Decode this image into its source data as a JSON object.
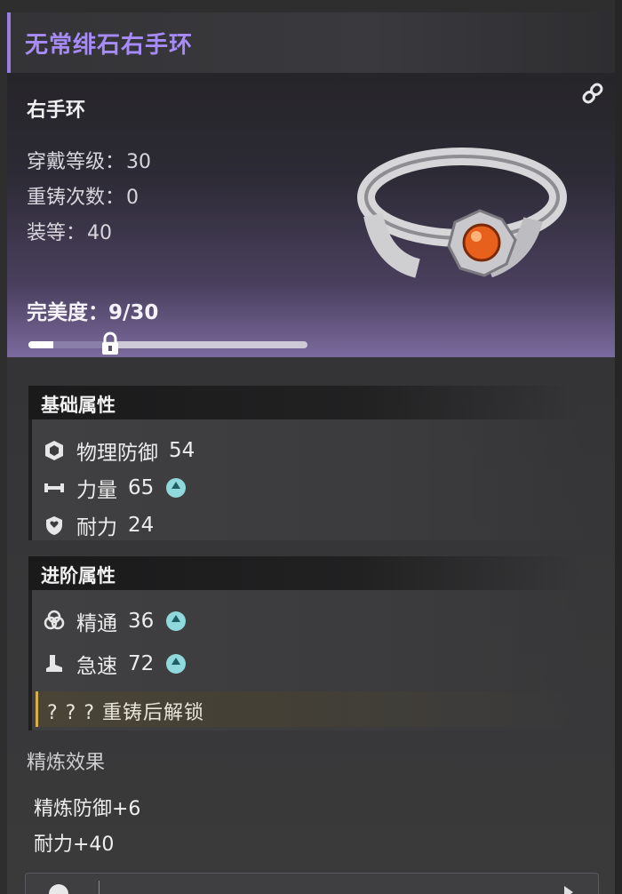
{
  "item": {
    "name": "无常绯石右手环",
    "slot": "右手环",
    "stats": [
      {
        "label": "穿戴等级：",
        "value": "30"
      },
      {
        "label": "重铸次数：",
        "value": "0"
      },
      {
        "label": "装等：",
        "value": "40"
      }
    ],
    "perfection": {
      "label": "完美度：",
      "value": "9/30",
      "progress": 0.3
    }
  },
  "base_attrs": {
    "title": "基础属性",
    "rows": [
      {
        "name": "物理防御",
        "value": "54",
        "icon": "shield-hex-icon",
        "upgrade": false
      },
      {
        "name": "力量",
        "value": "65",
        "icon": "dumbbell-icon",
        "upgrade": true
      },
      {
        "name": "耐力",
        "value": "24",
        "icon": "heart-shield-icon",
        "upgrade": false
      }
    ]
  },
  "adv_attrs": {
    "title": "进阶属性",
    "rows": [
      {
        "name": "精通",
        "value": "36",
        "icon": "mastery-icon",
        "upgrade": true
      },
      {
        "name": "急速",
        "value": "72",
        "icon": "boot-icon",
        "upgrade": true
      }
    ],
    "locked_text": "? ? ?  重铸后解锁"
  },
  "refine": {
    "title": "精炼效果",
    "items": [
      "精炼防御+6",
      "耐力+40"
    ]
  },
  "colors": {
    "title_purple": "#a78bfa",
    "upgrade_teal": "#8fd8dc",
    "locked_gold": "#d8b04a"
  }
}
